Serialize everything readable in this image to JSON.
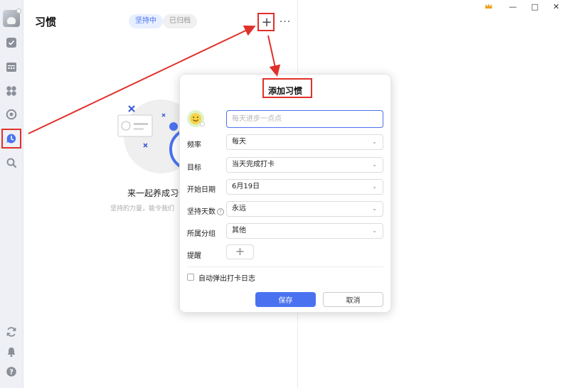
{
  "window": {
    "vip_icon": "crown-icon",
    "minimize_glyph": "—",
    "maximize_glyph": "□",
    "close_glyph": "✕"
  },
  "sidebar": {
    "items": [
      {
        "name": "task",
        "icon": "checkbox-icon"
      },
      {
        "name": "calendar",
        "icon": "calendar-icon"
      },
      {
        "name": "quadrant",
        "icon": "grid-icon"
      },
      {
        "name": "pomodoro",
        "icon": "focus-icon"
      },
      {
        "name": "habit",
        "icon": "habit-clock-icon",
        "active": true
      },
      {
        "name": "search",
        "icon": "search-icon"
      }
    ],
    "bottom": [
      {
        "name": "sync",
        "icon": "sync-icon"
      },
      {
        "name": "notifications",
        "icon": "bell-icon"
      },
      {
        "name": "help",
        "icon": "help-icon"
      }
    ],
    "active_color": "#4a72f0"
  },
  "header": {
    "title": "习惯",
    "tabs": [
      "坚持中",
      "已归档"
    ],
    "add_glyph": "+",
    "more_glyph": "···"
  },
  "empty_state": {
    "title": "来一起养成习惯",
    "subtitle": "坚持的力量，能令我们"
  },
  "dialog": {
    "title": "添加习惯",
    "name_placeholder": "每天进步一点点",
    "fields": {
      "frequency": {
        "label": "频率",
        "value": "每天"
      },
      "goal": {
        "label": "目标",
        "value": "当天完成打卡"
      },
      "start_date": {
        "label": "开始日期",
        "value": "6月19日"
      },
      "duration": {
        "label": "坚持天数",
        "value": "永远"
      },
      "group": {
        "label": "所属分组",
        "value": "其他"
      },
      "reminder": {
        "label": "提醒"
      }
    },
    "chevron_glyph": "⌄",
    "reminder_add_glyph": "+",
    "help_glyph": "?",
    "auto_log_label": "自动弹出打卡日志",
    "save_label": "保存",
    "cancel_label": "取消"
  },
  "colors": {
    "accent": "#4a72f0",
    "annotation": "#e0302b"
  }
}
